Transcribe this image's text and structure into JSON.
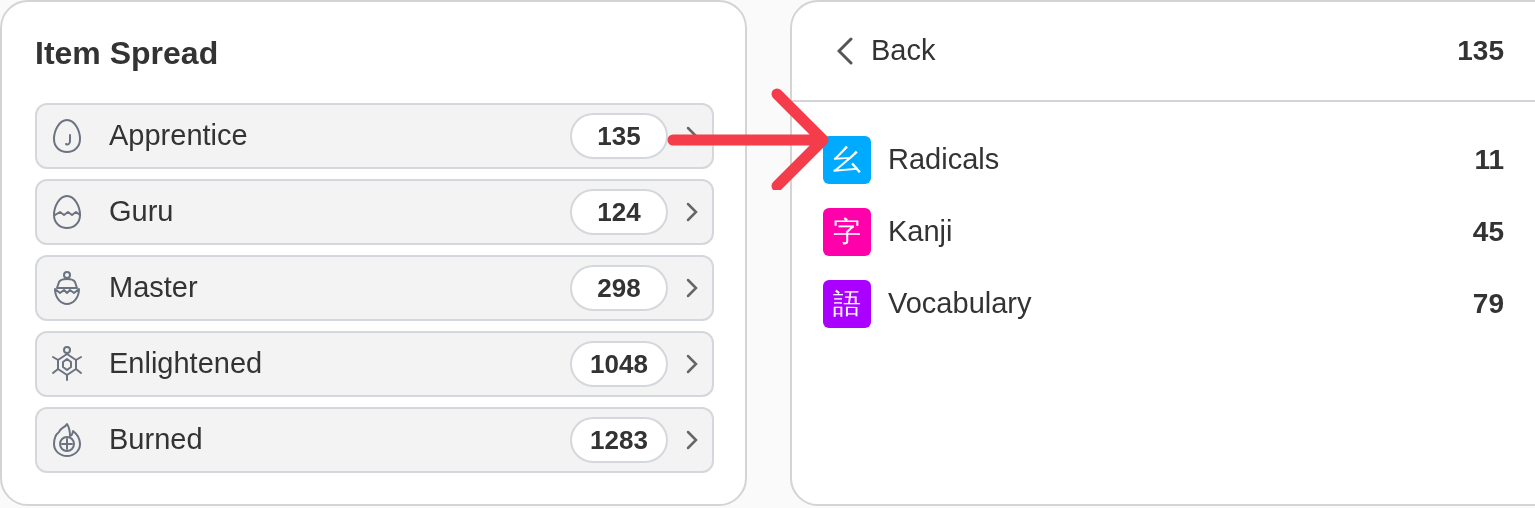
{
  "item_spread": {
    "title": "Item Spread",
    "items": [
      {
        "label": "Apprentice",
        "count": "135",
        "kind": "egg"
      },
      {
        "label": "Guru",
        "count": "124",
        "kind": "cracked-egg"
      },
      {
        "label": "Master",
        "count": "298",
        "kind": "hatching"
      },
      {
        "label": "Enlightened",
        "count": "1048",
        "kind": "turtle"
      },
      {
        "label": "Burned",
        "count": "1283",
        "kind": "burning"
      }
    ]
  },
  "detail": {
    "back": "Back",
    "total": "135",
    "items": [
      {
        "glyph": "幺",
        "label": "Radicals",
        "count": "11",
        "color": "#00aaff"
      },
      {
        "glyph": "字",
        "label": "Kanji",
        "count": "45",
        "color": "#ff00aa"
      },
      {
        "glyph": "語",
        "label": "Vocabulary",
        "count": "79",
        "color": "#aa00ff"
      }
    ]
  }
}
